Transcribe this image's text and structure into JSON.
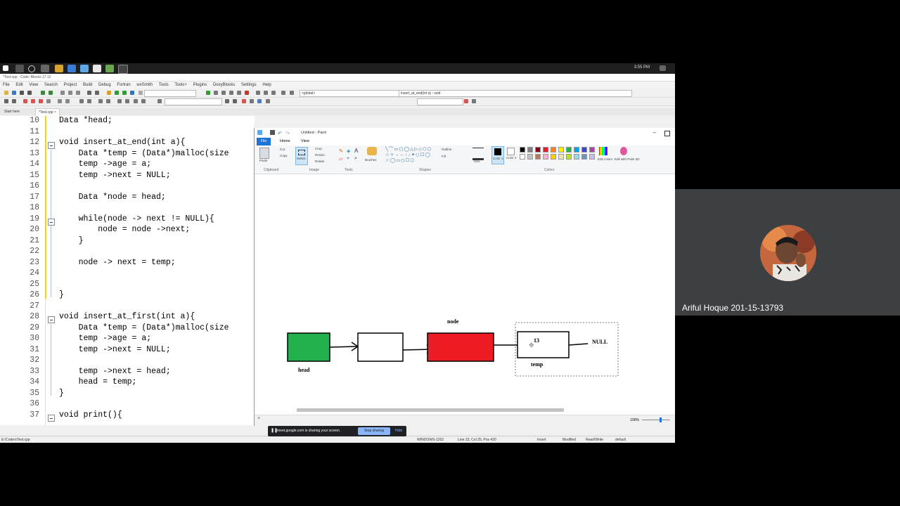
{
  "taskbar": {
    "clock": "3:55 PM"
  },
  "codeblocks": {
    "title": "*Test.cpp - Code::Blocks 17.12",
    "menu": [
      "File",
      "Edit",
      "View",
      "Search",
      "Project",
      "Build",
      "Debug",
      "Fortran",
      "wxSmith",
      "Tools",
      "Tools+",
      "Plugins",
      "DoxyBlocks",
      "Settings",
      "Help"
    ],
    "scope_dropdown": "<global>",
    "function_dropdown": "insert_at_end(int a) : void",
    "tabs": [
      {
        "label": "Start here",
        "active": false
      },
      {
        "label": "*Test.cpp",
        "active": true
      }
    ],
    "code_lines": [
      {
        "num": "10",
        "text": "Data *head;"
      },
      {
        "num": "11",
        "text": ""
      },
      {
        "num": "12",
        "text": "void insert_at_end(int a){"
      },
      {
        "num": "13",
        "text": "    Data *temp = (Data*)malloc(size"
      },
      {
        "num": "14",
        "text": "    temp ->age = a;"
      },
      {
        "num": "15",
        "text": "    temp ->next = NULL;"
      },
      {
        "num": "16",
        "text": ""
      },
      {
        "num": "17",
        "text": "    Data *node = head;"
      },
      {
        "num": "18",
        "text": ""
      },
      {
        "num": "19",
        "text": "    while(node -> next != NULL){"
      },
      {
        "num": "20",
        "text": "        node = node ->next;"
      },
      {
        "num": "21",
        "text": "    }"
      },
      {
        "num": "22",
        "text": ""
      },
      {
        "num": "23",
        "text": "    node -> next = temp;"
      },
      {
        "num": "24",
        "text": ""
      },
      {
        "num": "25",
        "text": ""
      },
      {
        "num": "26",
        "text": "}"
      },
      {
        "num": "27",
        "text": ""
      },
      {
        "num": "28",
        "text": "void insert_at_first(int a){"
      },
      {
        "num": "29",
        "text": "    Data *temp = (Data*)malloc(size"
      },
      {
        "num": "30",
        "text": "    temp ->age = a;"
      },
      {
        "num": "31",
        "text": "    temp ->next = NULL;"
      },
      {
        "num": "32",
        "text": ""
      },
      {
        "num": "33",
        "text": "    temp ->next = head;"
      },
      {
        "num": "34",
        "text": "    head = temp;"
      },
      {
        "num": "35",
        "text": "}"
      },
      {
        "num": "36",
        "text": ""
      },
      {
        "num": "37",
        "text": "void print(){"
      }
    ],
    "status": {
      "path": "E:\\Codes\\Test.cpp",
      "encoding": "WINDOWS-1252",
      "position": "Line 23, Col 25, Pos 420",
      "mode": "Insert",
      "modified": "Modified",
      "rw": "Read/Write",
      "profile": "default"
    }
  },
  "paint": {
    "title": "Untitled - Paint",
    "tabs": {
      "file": "File",
      "home": "Home",
      "view": "View"
    },
    "ribbon": {
      "paste": "Paste",
      "cut": "Cut",
      "copy": "Copy",
      "select": "Select",
      "crop": "Crop",
      "resize": "Resize",
      "rotate": "Rotate",
      "brushes": "Brushes",
      "outline": "Outline",
      "fill": "Fill",
      "size": "Size",
      "color1": "Color 1",
      "color2": "Color 2",
      "edit_colors": "Edit colors",
      "edit_paint3d": "Edit with Paint 3D",
      "groups": {
        "clipboard": "Clipboard",
        "image": "Image",
        "tools": "Tools",
        "shapes": "Shapes",
        "colors": "Colors"
      }
    },
    "palette": [
      "#000000",
      "#7f7f7f",
      "#880015",
      "#ed1c24",
      "#ff7f27",
      "#fff200",
      "#22b14c",
      "#00a2e8",
      "#3f48cc",
      "#a349a4",
      "#ffffff",
      "#c3c3c3",
      "#b97a57",
      "#ffaec9",
      "#ffc90e",
      "#efe4b0",
      "#b5e61d",
      "#99d9ea",
      "#7092be",
      "#c8bfe7"
    ],
    "zoom": "100%",
    "drawing": {
      "head_label": "head",
      "node_label": "node",
      "temp_label": "temp",
      "temp_value": "13",
      "null_label": "NULL",
      "colors": {
        "head": "#22b14c",
        "node": "#ed1c24",
        "empty": "#ffffff"
      }
    }
  },
  "meet": {
    "banner_text": "meet.google.com is sharing your screen.",
    "stop_label": "Stop sharing",
    "hide_label": "Hide",
    "participant_name": "Ariful Hoque 201-15-13793"
  }
}
